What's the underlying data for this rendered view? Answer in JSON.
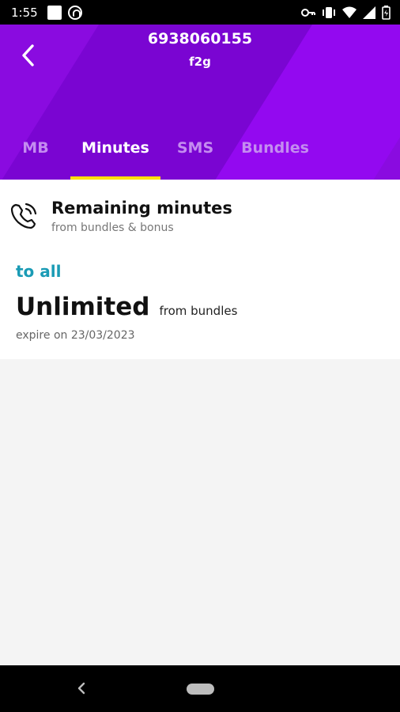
{
  "status_bar": {
    "time": "1:55",
    "icons": [
      "notification-square-icon",
      "data-saver-icon",
      "vpn-key-icon",
      "vibrate-icon",
      "wifi-icon",
      "signal-icon",
      "battery-icon"
    ]
  },
  "header": {
    "title": "6938060155",
    "subtitle": "f2g",
    "back_icon": "chevron-left-icon",
    "colors": {
      "background": "#8a0be0",
      "tab_underline": "#ffe000"
    }
  },
  "tabs": [
    {
      "label": "MB",
      "active": false
    },
    {
      "label": "Minutes",
      "active": true
    },
    {
      "label": "SMS",
      "active": false
    },
    {
      "label": "Bundles",
      "active": false
    }
  ],
  "card": {
    "icon": "phone-ringing-icon",
    "title": "Remaining minutes",
    "subtitle": "from bundles & bonus",
    "section_label": "to all",
    "amount": "Unlimited",
    "amount_note": "from bundles",
    "expire_text": "expire on 23/03/2023",
    "colors": {
      "section_label": "#1a9bb5"
    }
  },
  "nav_bar": {
    "icons": [
      "nav-back-icon",
      "nav-home-pill-icon"
    ]
  }
}
